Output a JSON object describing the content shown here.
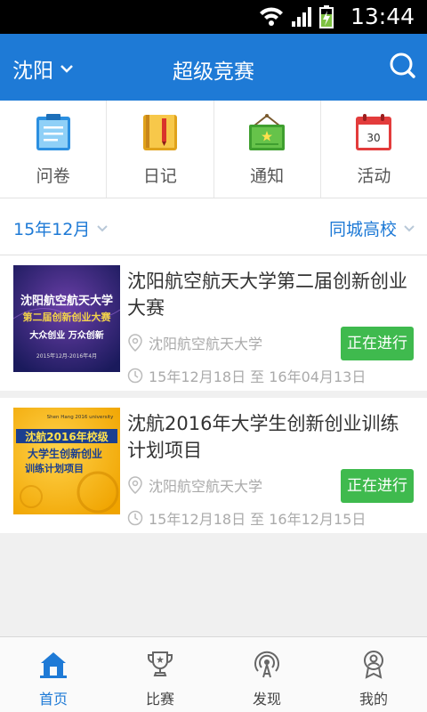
{
  "status_bar": {
    "time": "13:44"
  },
  "app_bar": {
    "city": "沈阳",
    "title": "超级竞赛"
  },
  "quick_menu": [
    {
      "label": "问卷",
      "icon": "questionnaire-icon"
    },
    {
      "label": "日记",
      "icon": "diary-icon"
    },
    {
      "label": "通知",
      "icon": "notice-icon"
    },
    {
      "label": "活动",
      "icon": "calendar-icon",
      "icon_text": "30"
    }
  ],
  "filters": {
    "month": "15年12月",
    "scope": "同城高校"
  },
  "competitions": [
    {
      "title": "沈阳航空航天大学第二届创新创业大赛",
      "location": "沈阳航空航天大学",
      "date_range": "15年12月18日 至 16年04月13日",
      "status": "正在进行",
      "poster": {
        "line1": "沈阳航空航天大学",
        "line2": "第二届创新创业大赛",
        "line3": "大众创业 万众创新",
        "line4": "2015年12月-2016年4月"
      }
    },
    {
      "title": "沈航2016年大学生创新创业训练计划项目",
      "location": "沈阳航空航天大学",
      "date_range": "15年12月18日 至 16年12月15日",
      "status": "正在进行",
      "poster": {
        "line1": "Shen Hang 2016 university",
        "line2": "沈航2016年校级",
        "line3": "大学生创新创业",
        "line4": "训练计划项目"
      }
    }
  ],
  "bottom_nav": [
    {
      "label": "首页",
      "icon": "home-icon",
      "active": true
    },
    {
      "label": "比赛",
      "icon": "trophy-icon",
      "active": false
    },
    {
      "label": "发现",
      "icon": "discover-icon",
      "active": false
    },
    {
      "label": "我的",
      "icon": "profile-icon",
      "active": false
    }
  ],
  "colors": {
    "primary": "#1e7ad6",
    "status_green": "#3fba4e",
    "text_gray": "#aaaaaa"
  }
}
